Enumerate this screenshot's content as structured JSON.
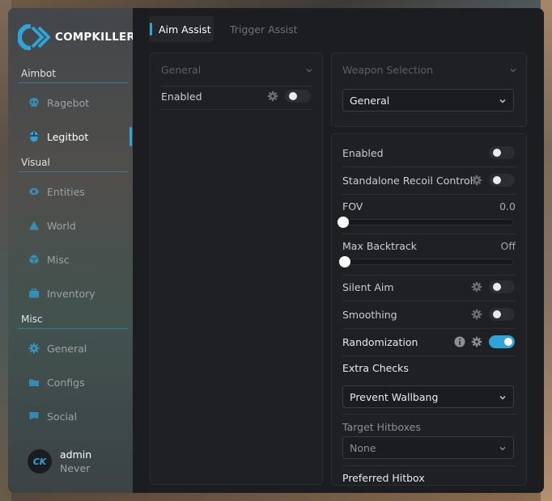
{
  "brand": {
    "name": "COMPKILLER",
    "avatar_text": "CK"
  },
  "colors": {
    "accent": "#2ea3d8",
    "bg": "#1c1d20",
    "panel": "#1f2023"
  },
  "sidebar": {
    "sections": [
      {
        "label": "Aimbot"
      },
      {
        "label": "Visual"
      },
      {
        "label": "Misc"
      }
    ],
    "items": [
      {
        "label": "Ragebot",
        "icon": "skull-icon"
      },
      {
        "label": "Legitbot",
        "icon": "mouse-icon",
        "active": true
      },
      {
        "label": "Entities",
        "icon": "eye-icon"
      },
      {
        "label": "World",
        "icon": "triangle-icon"
      },
      {
        "label": "Misc",
        "icon": "cube-icon"
      },
      {
        "label": "Inventory",
        "icon": "briefcase-icon"
      },
      {
        "label": "General",
        "icon": "gear-icon"
      },
      {
        "label": "Configs",
        "icon": "folder-icon"
      },
      {
        "label": "Social",
        "icon": "chat-icon"
      }
    ],
    "user": {
      "name": "admin",
      "subtitle": "Never"
    }
  },
  "tabs": [
    {
      "label": "Aim Assist",
      "active": true
    },
    {
      "label": "Trigger Assist",
      "active": false
    }
  ],
  "general_panel": {
    "header": "General",
    "enabled_label": "Enabled",
    "enabled": false
  },
  "weapon_panel": {
    "header": "Weapon Selection",
    "selected": "General"
  },
  "settings": {
    "enabled_label": "Enabled",
    "enabled": false,
    "recoil_label": "Standalone Recoil Control",
    "recoil": false,
    "fov_label": "FOV",
    "fov_value": "0.0",
    "fov_fraction": 0,
    "backtrack_label": "Max Backtrack",
    "backtrack_value": "Off",
    "backtrack_fraction": 0,
    "silent_label": "Silent Aim",
    "silent": false,
    "smoothing_label": "Smoothing",
    "smoothing": false,
    "random_label": "Randomization",
    "random": true,
    "extra_checks_label": "Extra Checks",
    "extra_checks_value": "Prevent Wallbang",
    "hitboxes_label": "Target Hitboxes",
    "hitboxes_value": "None",
    "preferred_label": "Preferred Hitbox"
  }
}
